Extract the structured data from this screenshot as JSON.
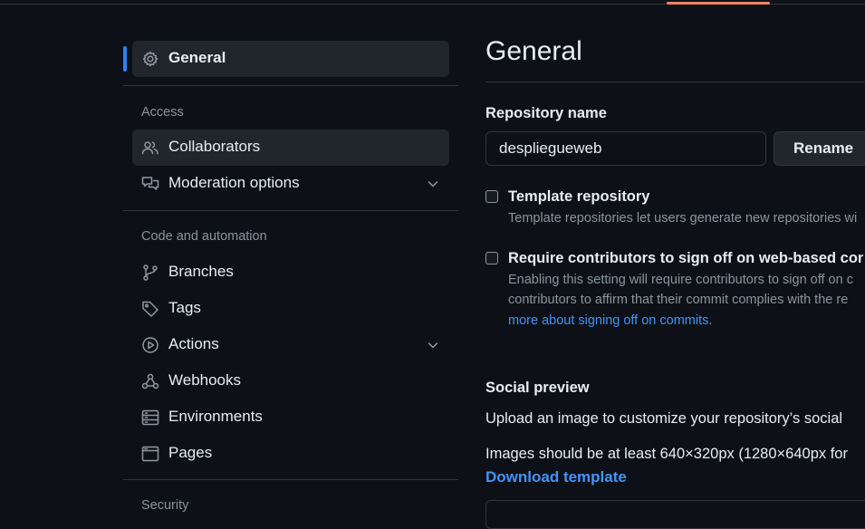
{
  "sidebar": {
    "general": "General",
    "groups": {
      "access": "Access",
      "code_automation": "Code and automation",
      "security": "Security"
    },
    "items": {
      "collaborators": "Collaborators",
      "moderation": "Moderation options",
      "branches": "Branches",
      "tags": "Tags",
      "actions": "Actions",
      "webhooks": "Webhooks",
      "environments": "Environments",
      "pages": "Pages"
    },
    "icons": [
      "gear-icon",
      "people-icon",
      "comment-discussion-icon",
      "git-branch-icon",
      "tag-icon",
      "play-icon",
      "webhook-icon",
      "server-icon",
      "browser-icon",
      "chevron-down-icon"
    ]
  },
  "main": {
    "title": "General",
    "repo_name_label": "Repository name",
    "repo_name_value": "despliegueweb",
    "rename_button": "Rename",
    "template": {
      "label": "Template repository",
      "description": "Template repositories let users generate new repositories wi"
    },
    "signoff": {
      "label": "Require contributors to sign off on web-based cor",
      "line1": "Enabling this setting will require contributors to sign off on c",
      "line2": "contributors to affirm that their commit complies with the re",
      "link": "more about signing off on commits",
      "link_suffix": "."
    },
    "social": {
      "heading": "Social preview",
      "text1": "Upload an image to customize your repository’s social",
      "text2": "Images should be at least 640×320px (1280×640px for",
      "download": "Download template"
    }
  },
  "colors": {
    "background": "#0d1117",
    "accent": "#2f81f7",
    "link": "#4493f8",
    "tab_underline": "#f78166"
  }
}
